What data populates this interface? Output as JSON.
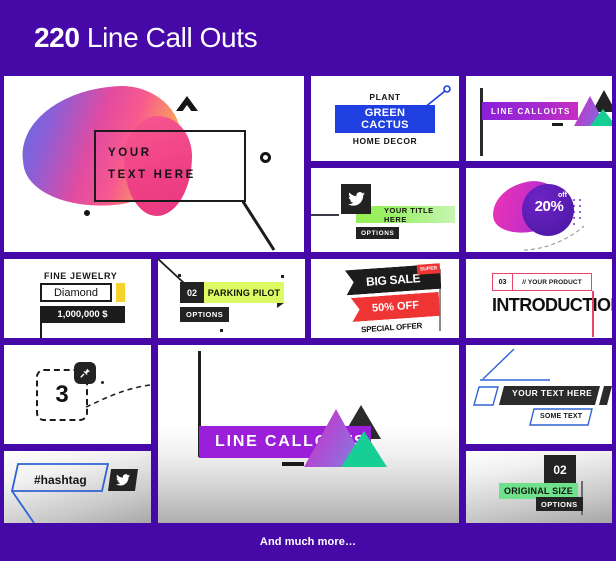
{
  "theme": {
    "purple": "#4609a8",
    "accent_magenta": "#c62fc0",
    "accent_teal": "#17cf95",
    "accent_blue": "#1f3fe0",
    "accent_red": "#ef3434",
    "accent_pink": "#e8436b",
    "accent_yellow": "#f6d32b",
    "accent_lime": "#ddf964",
    "accent_green": "#6fe08c"
  },
  "header": {
    "count": "220",
    "title": " Line Call Outs"
  },
  "footer": {
    "text": "And much more…"
  },
  "panels": {
    "hero": {
      "name": "hero-text-panel",
      "text": "YOUR\nTEXT HERE"
    },
    "plant": {
      "name": "plant-callout-panel",
      "top_label": "PLANT",
      "highlight_label": "GREEN CACTUS",
      "bottom_label": "HOME DECOR"
    },
    "line_callouts_small": {
      "name": "line-callouts-small-panel",
      "label": "LINE CALLOUTS"
    },
    "twitter": {
      "name": "twitter-title-panel",
      "title": "YOUR TITLE HERE",
      "options_label": "OPTIONS"
    },
    "discount": {
      "name": "discount-blob-panel",
      "percent": "20%",
      "off_label": "off"
    },
    "jewelry": {
      "name": "fine-jewelry-panel",
      "title": "FINE JEWELRY",
      "item": "Diamond",
      "price": "1,000,000 $"
    },
    "parking": {
      "name": "parking-pilot-panel",
      "number": "02",
      "label": "PARKING PILOT",
      "options_label": "OPTIONS"
    },
    "big_sale": {
      "name": "big-sale-panel",
      "super_label": "SUPER",
      "headline": "BIG SALE",
      "discount": "50% OFF",
      "sub": "SPECIAL OFFER"
    },
    "introduction": {
      "name": "introduction-panel",
      "number": "03",
      "product": "// YOUR PRODUCT",
      "title": "INTRODUCTION"
    },
    "three": {
      "name": "number-three-panel",
      "number": "3"
    },
    "big_callout": {
      "name": "line-callouts-big-panel",
      "label": "LINE CALLOUTS"
    },
    "your_text": {
      "name": "your-text-here-panel",
      "plus": "+",
      "main": "YOUR TEXT HERE",
      "sub": "SOME TEXT"
    },
    "hashtag": {
      "name": "hashtag-panel",
      "text": "#hashtag"
    },
    "original_size": {
      "name": "original-size-panel",
      "number": "02",
      "label": "ORIGINAL SIZE",
      "options_label": "OPTIONS"
    }
  }
}
